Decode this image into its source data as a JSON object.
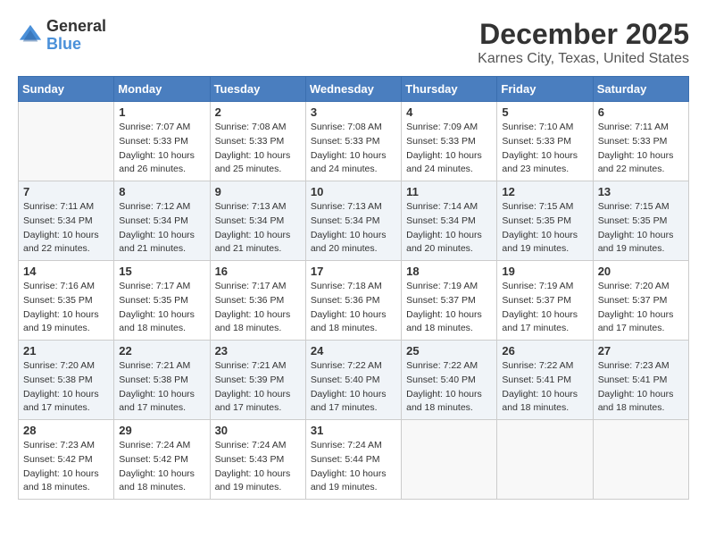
{
  "logo": {
    "general": "General",
    "blue": "Blue"
  },
  "title": "December 2025",
  "subtitle": "Karnes City, Texas, United States",
  "days_header": [
    "Sunday",
    "Monday",
    "Tuesday",
    "Wednesday",
    "Thursday",
    "Friday",
    "Saturday"
  ],
  "weeks": [
    [
      {
        "day": "",
        "sunrise": "",
        "sunset": "",
        "daylight": ""
      },
      {
        "day": "1",
        "sunrise": "Sunrise: 7:07 AM",
        "sunset": "Sunset: 5:33 PM",
        "daylight": "Daylight: 10 hours and 26 minutes."
      },
      {
        "day": "2",
        "sunrise": "Sunrise: 7:08 AM",
        "sunset": "Sunset: 5:33 PM",
        "daylight": "Daylight: 10 hours and 25 minutes."
      },
      {
        "day": "3",
        "sunrise": "Sunrise: 7:08 AM",
        "sunset": "Sunset: 5:33 PM",
        "daylight": "Daylight: 10 hours and 24 minutes."
      },
      {
        "day": "4",
        "sunrise": "Sunrise: 7:09 AM",
        "sunset": "Sunset: 5:33 PM",
        "daylight": "Daylight: 10 hours and 24 minutes."
      },
      {
        "day": "5",
        "sunrise": "Sunrise: 7:10 AM",
        "sunset": "Sunset: 5:33 PM",
        "daylight": "Daylight: 10 hours and 23 minutes."
      },
      {
        "day": "6",
        "sunrise": "Sunrise: 7:11 AM",
        "sunset": "Sunset: 5:33 PM",
        "daylight": "Daylight: 10 hours and 22 minutes."
      }
    ],
    [
      {
        "day": "7",
        "sunrise": "Sunrise: 7:11 AM",
        "sunset": "Sunset: 5:34 PM",
        "daylight": "Daylight: 10 hours and 22 minutes."
      },
      {
        "day": "8",
        "sunrise": "Sunrise: 7:12 AM",
        "sunset": "Sunset: 5:34 PM",
        "daylight": "Daylight: 10 hours and 21 minutes."
      },
      {
        "day": "9",
        "sunrise": "Sunrise: 7:13 AM",
        "sunset": "Sunset: 5:34 PM",
        "daylight": "Daylight: 10 hours and 21 minutes."
      },
      {
        "day": "10",
        "sunrise": "Sunrise: 7:13 AM",
        "sunset": "Sunset: 5:34 PM",
        "daylight": "Daylight: 10 hours and 20 minutes."
      },
      {
        "day": "11",
        "sunrise": "Sunrise: 7:14 AM",
        "sunset": "Sunset: 5:34 PM",
        "daylight": "Daylight: 10 hours and 20 minutes."
      },
      {
        "day": "12",
        "sunrise": "Sunrise: 7:15 AM",
        "sunset": "Sunset: 5:35 PM",
        "daylight": "Daylight: 10 hours and 19 minutes."
      },
      {
        "day": "13",
        "sunrise": "Sunrise: 7:15 AM",
        "sunset": "Sunset: 5:35 PM",
        "daylight": "Daylight: 10 hours and 19 minutes."
      }
    ],
    [
      {
        "day": "14",
        "sunrise": "Sunrise: 7:16 AM",
        "sunset": "Sunset: 5:35 PM",
        "daylight": "Daylight: 10 hours and 19 minutes."
      },
      {
        "day": "15",
        "sunrise": "Sunrise: 7:17 AM",
        "sunset": "Sunset: 5:35 PM",
        "daylight": "Daylight: 10 hours and 18 minutes."
      },
      {
        "day": "16",
        "sunrise": "Sunrise: 7:17 AM",
        "sunset": "Sunset: 5:36 PM",
        "daylight": "Daylight: 10 hours and 18 minutes."
      },
      {
        "day": "17",
        "sunrise": "Sunrise: 7:18 AM",
        "sunset": "Sunset: 5:36 PM",
        "daylight": "Daylight: 10 hours and 18 minutes."
      },
      {
        "day": "18",
        "sunrise": "Sunrise: 7:19 AM",
        "sunset": "Sunset: 5:37 PM",
        "daylight": "Daylight: 10 hours and 18 minutes."
      },
      {
        "day": "19",
        "sunrise": "Sunrise: 7:19 AM",
        "sunset": "Sunset: 5:37 PM",
        "daylight": "Daylight: 10 hours and 17 minutes."
      },
      {
        "day": "20",
        "sunrise": "Sunrise: 7:20 AM",
        "sunset": "Sunset: 5:37 PM",
        "daylight": "Daylight: 10 hours and 17 minutes."
      }
    ],
    [
      {
        "day": "21",
        "sunrise": "Sunrise: 7:20 AM",
        "sunset": "Sunset: 5:38 PM",
        "daylight": "Daylight: 10 hours and 17 minutes."
      },
      {
        "day": "22",
        "sunrise": "Sunrise: 7:21 AM",
        "sunset": "Sunset: 5:38 PM",
        "daylight": "Daylight: 10 hours and 17 minutes."
      },
      {
        "day": "23",
        "sunrise": "Sunrise: 7:21 AM",
        "sunset": "Sunset: 5:39 PM",
        "daylight": "Daylight: 10 hours and 17 minutes."
      },
      {
        "day": "24",
        "sunrise": "Sunrise: 7:22 AM",
        "sunset": "Sunset: 5:40 PM",
        "daylight": "Daylight: 10 hours and 17 minutes."
      },
      {
        "day": "25",
        "sunrise": "Sunrise: 7:22 AM",
        "sunset": "Sunset: 5:40 PM",
        "daylight": "Daylight: 10 hours and 18 minutes."
      },
      {
        "day": "26",
        "sunrise": "Sunrise: 7:22 AM",
        "sunset": "Sunset: 5:41 PM",
        "daylight": "Daylight: 10 hours and 18 minutes."
      },
      {
        "day": "27",
        "sunrise": "Sunrise: 7:23 AM",
        "sunset": "Sunset: 5:41 PM",
        "daylight": "Daylight: 10 hours and 18 minutes."
      }
    ],
    [
      {
        "day": "28",
        "sunrise": "Sunrise: 7:23 AM",
        "sunset": "Sunset: 5:42 PM",
        "daylight": "Daylight: 10 hours and 18 minutes."
      },
      {
        "day": "29",
        "sunrise": "Sunrise: 7:24 AM",
        "sunset": "Sunset: 5:42 PM",
        "daylight": "Daylight: 10 hours and 18 minutes."
      },
      {
        "day": "30",
        "sunrise": "Sunrise: 7:24 AM",
        "sunset": "Sunset: 5:43 PM",
        "daylight": "Daylight: 10 hours and 19 minutes."
      },
      {
        "day": "31",
        "sunrise": "Sunrise: 7:24 AM",
        "sunset": "Sunset: 5:44 PM",
        "daylight": "Daylight: 10 hours and 19 minutes."
      },
      {
        "day": "",
        "sunrise": "",
        "sunset": "",
        "daylight": ""
      },
      {
        "day": "",
        "sunrise": "",
        "sunset": "",
        "daylight": ""
      },
      {
        "day": "",
        "sunrise": "",
        "sunset": "",
        "daylight": ""
      }
    ]
  ]
}
